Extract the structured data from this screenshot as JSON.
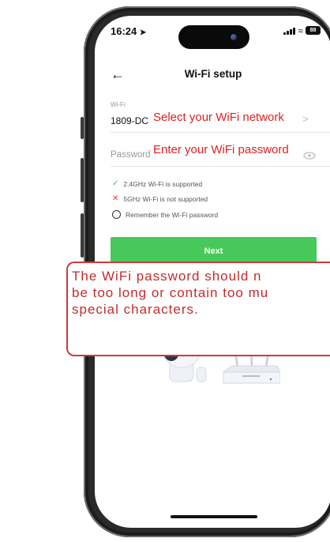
{
  "status_bar": {
    "time": "16:24",
    "battery": "88"
  },
  "header": {
    "title": "Wi-Fi setup"
  },
  "wifi": {
    "label": "Wi-Fi",
    "ssid": "1809-DC",
    "select_hint": "Select your WiFi network",
    "chevron": ">"
  },
  "password": {
    "placeholder": "Password",
    "hint": "Enter your WiFi password"
  },
  "requirements": [
    {
      "icon": "check-icon",
      "text": "2.4GHz Wi-Fi is supported"
    },
    {
      "icon": "cross-icon",
      "text": "5GHz Wi-Fi is not supported"
    }
  ],
  "remember": {
    "label": "Remember the Wi-Fi password"
  },
  "next_button": {
    "label": "Next"
  },
  "callout": {
    "lines": [
      "The WiFi password should n",
      "be too long or contain too mu",
      "special characters."
    ]
  },
  "colors": {
    "accent_green": "#46c85a",
    "hint_red": "#e02020",
    "callout_border": "#d03a3a"
  }
}
